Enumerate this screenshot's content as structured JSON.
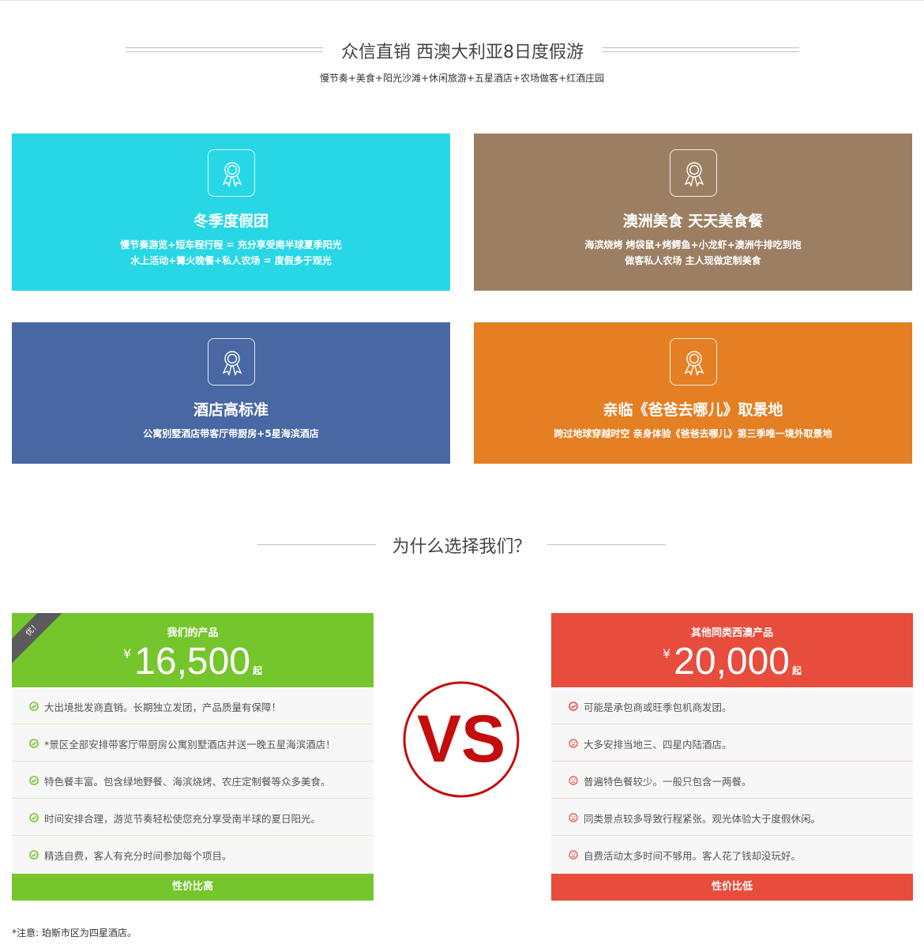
{
  "header": {
    "title": "众信直销 西澳大利亚8日度假游",
    "subtitle": "慢节奏+美食+阳光沙滩+休闲旅游+五星酒店+农场做客+红酒庄园"
  },
  "features": [
    {
      "title": "冬季度假团",
      "lines": [
        "慢节奏游览+短车程行程 = 充分享受南半球夏季阳光",
        "水上活动+篝火晚餐+私人农场 = 度假多于观光"
      ],
      "color": "#27d7e6",
      "icon": "award-ribbon-icon"
    },
    {
      "title": "澳洲美食 天天美食餐",
      "lines": [
        "海滨烧烤 烤袋鼠+烤鳄鱼+小龙虾+澳洲牛排吃到饱",
        "做客私人农场 主人现做定制美食"
      ],
      "color": "#9c7f63",
      "icon": "award-ribbon-icon"
    },
    {
      "title": "酒店高标准",
      "lines": [
        "公寓别墅酒店带客厅带厨房+5星海滨酒店"
      ],
      "color": "#4867a3",
      "icon": "award-ribbon-icon"
    },
    {
      "title": "亲临《爸爸去哪儿》取景地",
      "lines": [
        "跨过地球穿越时空 亲身体验《爸爸去哪儿》第三季唯一境外取景地"
      ],
      "color": "#e47f24",
      "icon": "award-ribbon-icon"
    }
  ],
  "why": {
    "title": "为什么选择我们？"
  },
  "ours": {
    "ribbon": "优！",
    "label": "我们的产品",
    "currency": "¥",
    "price": "16,500",
    "suffix": "起",
    "items": [
      "大出境批发商直销。长期独立发团，产品质量有保障！",
      "*景区全部安排带客厅带厨房公寓别墅酒店并送一晚五星海滨酒店！",
      "特色餐丰富。包含绿地野餐、海滨烧烤、农庄定制餐等众多美食。",
      "时间安排合理，游览节奏轻松使您充分享受南半球的夏日阳光。",
      "精选自费，客人有充分时间参加每个项目。"
    ],
    "footer": "性价比高",
    "color": "#75c52c",
    "icon": "check-circle-icon"
  },
  "vs": {
    "text": "VS",
    "color": "#c40d0d"
  },
  "others": {
    "label": "其他同类西澳产品",
    "currency": "¥",
    "price": "20,000",
    "suffix": "起",
    "items": [
      "可能是承包商或旺季包机商发团。",
      "大多安排当地三、四星内陆酒店。",
      "普遍特色餐较少。一般只包含一两餐。",
      "同类景点较多导致行程紧张。观光体验大于度假休闲。",
      "自费活动太多时间不够用。客人花了钱却没玩好。"
    ],
    "footer": "性价比低",
    "color": "#e74c3c",
    "icons": [
      "check-circle-icon",
      "sad-face-icon",
      "sad-face-icon",
      "sad-face-icon",
      "sad-face-icon"
    ]
  },
  "note": "*注意: 珀斯市区为四星酒店。"
}
